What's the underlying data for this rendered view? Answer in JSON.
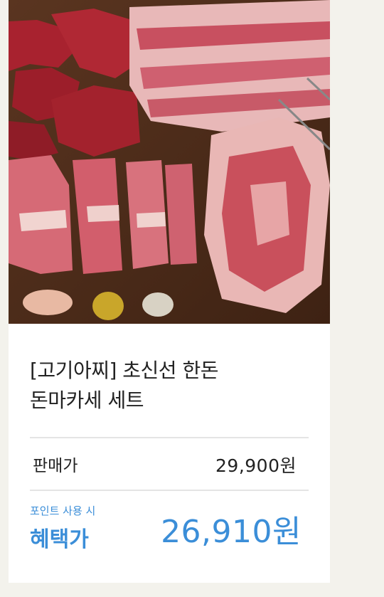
{
  "product": {
    "title_line1": "[고기아찌] 초신선 한돈",
    "title_line2": "돈마카세 세트",
    "sale_price_label": "판매가",
    "sale_price": "29,900원",
    "point_note": "포인트 사용 시",
    "benefit_label": "혜택가",
    "benefit_price": "26,910원"
  },
  "colors": {
    "accent": "#3b8ed8",
    "text": "#222222",
    "divider": "#e4e4e4",
    "page_bg": "#f3f2ec"
  }
}
